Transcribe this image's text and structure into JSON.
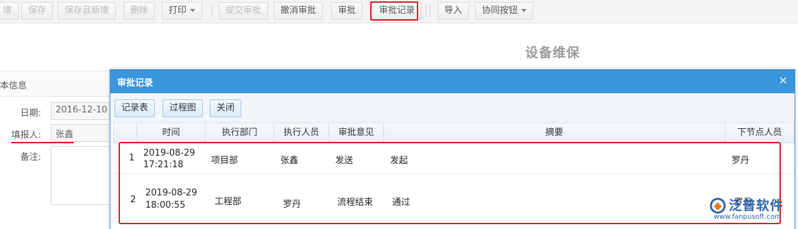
{
  "toolbar": {
    "buttons": [
      {
        "label": "增",
        "disabled": true
      },
      {
        "label": "保存",
        "disabled": true
      },
      {
        "label": "保存且新增",
        "disabled": true
      },
      {
        "label": "删除",
        "disabled": true
      },
      {
        "label": "打印",
        "disabled": false
      },
      {
        "label": "提交审批",
        "disabled": true
      },
      {
        "label": "撤消审批",
        "disabled": false
      },
      {
        "label": "审批",
        "disabled": false
      },
      {
        "label": "审批记录",
        "disabled": false
      },
      {
        "label": "导入",
        "disabled": false
      },
      {
        "label": "协同按钮",
        "disabled": false
      }
    ]
  },
  "page": {
    "title": "设备维保"
  },
  "form": {
    "section_title": "本信息",
    "date_label": "日期:",
    "date_value": "2016-12-10",
    "reporter_label": "填报人:",
    "reporter_value": "张鑫",
    "note_label": "备注:"
  },
  "dialog": {
    "title": "审批记录",
    "close_glyph": "✕",
    "buttons": {
      "record_table": "记录表",
      "process_chart": "过程图",
      "close": "关闭"
    },
    "columns": [
      "时间",
      "执行部门",
      "执行人员",
      "审批意见",
      "摘要",
      "下节点人员"
    ],
    "rows": [
      {
        "index": "1",
        "date": "2019-08-29",
        "time": "17:21:18",
        "dept": "项目部",
        "person": "张鑫",
        "opinion": "发送",
        "summary": "发起",
        "next": "罗丹"
      },
      {
        "index": "2",
        "date": "2019-08-29",
        "time": "18:00:55",
        "dept": "工程部",
        "person": "罗丹",
        "opinion": "流程结束",
        "summary": "通过",
        "next": "罗丹"
      }
    ]
  },
  "watermark": {
    "brand": "泛普软件",
    "url": "www.fanpusoft.com"
  },
  "colors": {
    "dialog_header": "#3a96dc",
    "highlight_red": "#e3161c",
    "brand_blue": "#2f63a8"
  }
}
